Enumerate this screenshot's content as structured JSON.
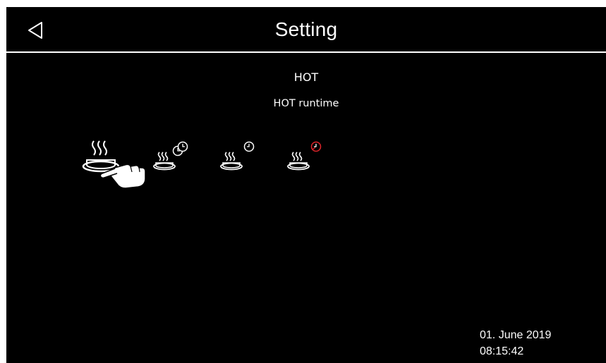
{
  "header": {
    "title": "Setting",
    "back_icon": "back-triangle-icon"
  },
  "content": {
    "mode_label": "HOT",
    "submode_label": "HOT runtime"
  },
  "icons": [
    {
      "name": "hot-mode-icon",
      "selected": true
    },
    {
      "name": "hot-timer-icon"
    },
    {
      "name": "hot-clock-icon"
    },
    {
      "name": "hot-clock-off-icon",
      "accent": "#e0242a"
    }
  ],
  "footer": {
    "date": "01. June 2019",
    "time": "08:15:42"
  },
  "colors": {
    "background": "#000000",
    "foreground": "#ffffff",
    "alert": "#e0242a"
  }
}
